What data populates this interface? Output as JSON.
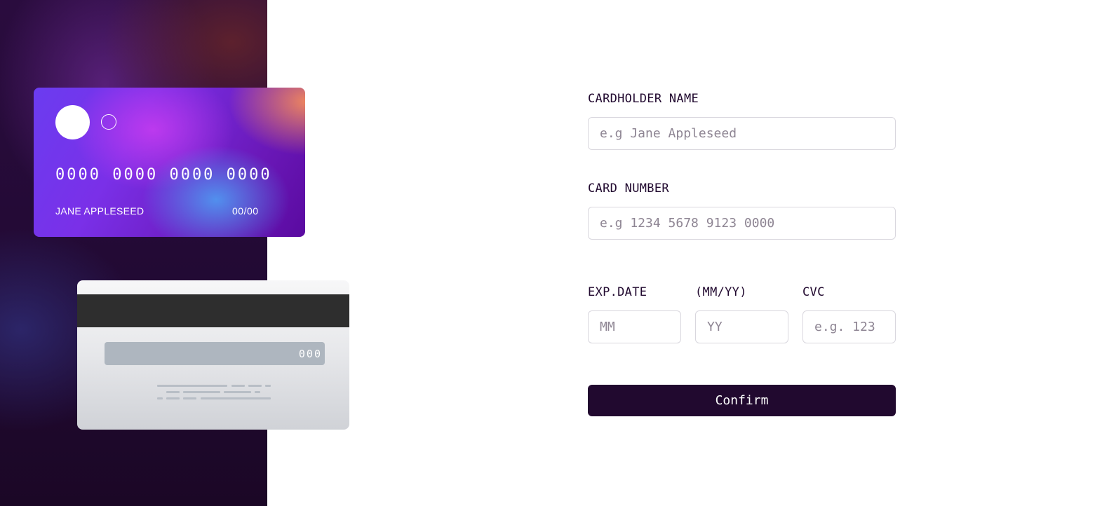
{
  "card_front": {
    "number": "0000 0000 0000 0000",
    "name": "JANE APPLESEED",
    "expiry": "00/00"
  },
  "card_back": {
    "cvc": "000"
  },
  "form": {
    "name_label": "CARDHOLDER NAME",
    "name_placeholder": "e.g Jane Appleseed",
    "number_label": "CARD NUMBER",
    "number_placeholder": "e.g 1234 5678 9123 0000",
    "exp_label": "EXP.DATE",
    "exp_format_label": "(MM/YY)",
    "month_placeholder": "MM",
    "year_placeholder": "YY",
    "cvc_label": "CVC",
    "cvc_placeholder": "e.g. 123",
    "confirm_label": "Confirm"
  },
  "colors": {
    "accent": "#21092f",
    "input_border": "#d9d7de",
    "placeholder": "#8e8593"
  }
}
